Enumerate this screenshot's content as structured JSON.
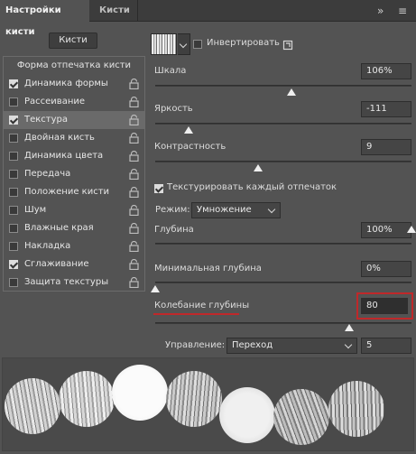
{
  "tabs": {
    "active": "Настройки кисти",
    "inactive": "Кисти"
  },
  "brushes_button": "Кисти",
  "left_list": {
    "header": "Форма отпечатка кисти",
    "items": [
      {
        "label": "Динамика формы",
        "checked": true
      },
      {
        "label": "Рассеивание",
        "checked": false
      },
      {
        "label": "Текстура",
        "checked": true,
        "selected": true
      },
      {
        "label": "Двойная кисть",
        "checked": false
      },
      {
        "label": "Динамика цвета",
        "checked": false
      },
      {
        "label": "Передача",
        "checked": false
      },
      {
        "label": "Положение кисти",
        "checked": false
      },
      {
        "label": "Шум",
        "checked": false
      },
      {
        "label": "Влажные края",
        "checked": false
      },
      {
        "label": "Накладка",
        "checked": false
      },
      {
        "label": "Сглаживание",
        "checked": true
      },
      {
        "label": "Защита текстуры",
        "checked": false
      }
    ]
  },
  "texture": {
    "invert_label": "Инвертировать",
    "invert_checked": false,
    "scale": {
      "label": "Шкала",
      "value": "106%",
      "level": 0.53
    },
    "brightness": {
      "label": "Яркость",
      "value": "-111",
      "level": 0.13
    },
    "contrast": {
      "label": "Контрастность",
      "value": "9",
      "level": 0.4
    },
    "each_tip": {
      "label": "Текстурировать каждый отпечаток",
      "checked": true
    },
    "mode": {
      "label": "Режим:",
      "value": "Умножение"
    },
    "depth": {
      "label": "Глубина",
      "value": "100%",
      "level": 1.0
    },
    "min_depth": {
      "label": "Минимальная глубина",
      "value": "0%",
      "level": 0.0
    },
    "depth_jitter": {
      "label": "Колебание глубины",
      "value": "80",
      "level": 0.8
    },
    "control": {
      "label": "Управление:",
      "value": "Переход",
      "steps": "5"
    }
  },
  "highlight_color": "#c0282a",
  "accent_underline_color": "#c0282a"
}
